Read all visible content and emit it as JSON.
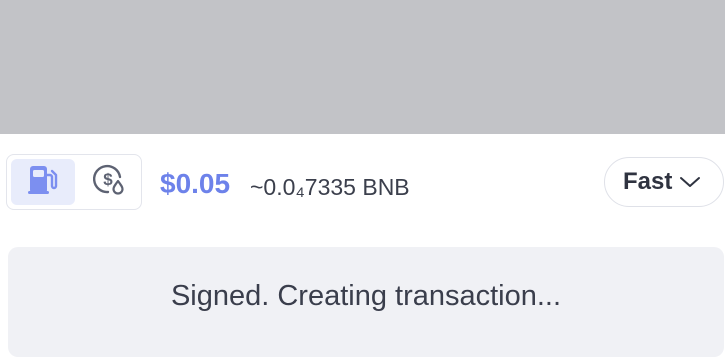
{
  "fee": {
    "usd": "$0.05",
    "native": "~0.0₄7335 BNB",
    "accent_color": "#6d82ea"
  },
  "fee_mode": {
    "options": [
      {
        "icon": "gas-pump-icon",
        "selected": true
      },
      {
        "icon": "dollar-coin-drop-icon",
        "selected": false
      }
    ]
  },
  "speed": {
    "selected": "Fast",
    "icon": "chevron-down-icon"
  },
  "status": {
    "message": "Signed. Creating transaction..."
  }
}
